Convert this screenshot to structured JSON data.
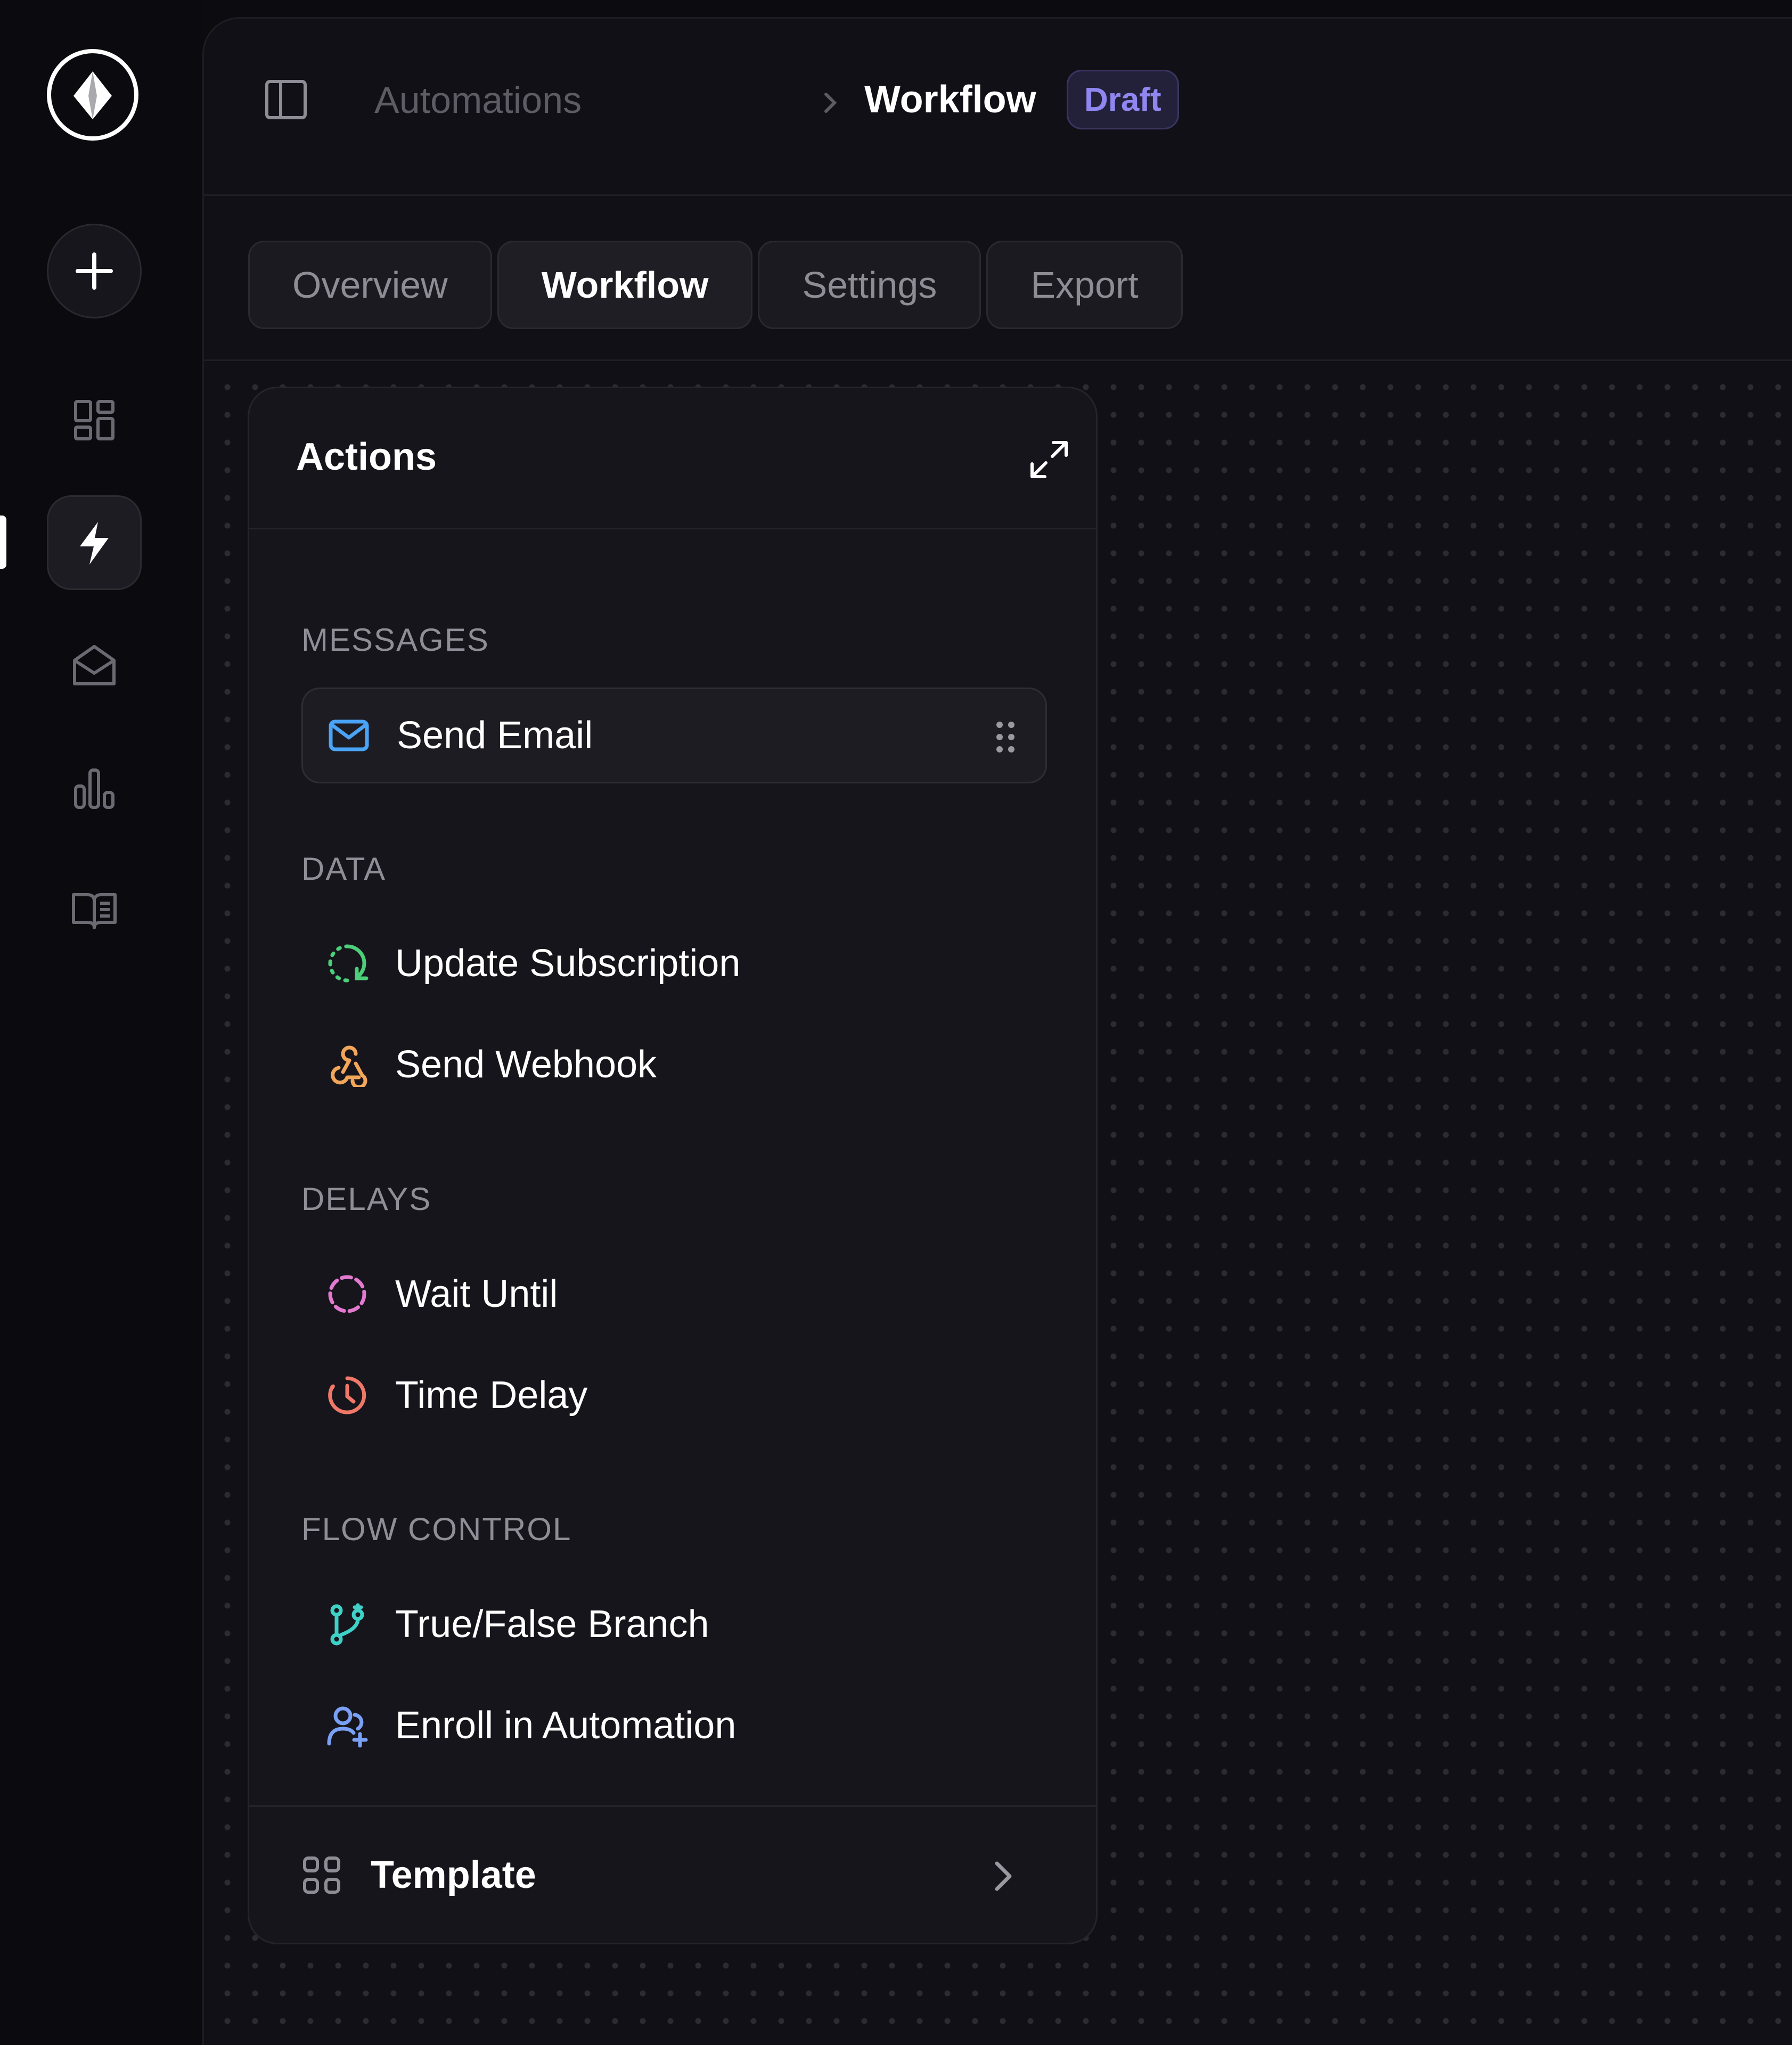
{
  "breadcrumb": {
    "parent": "Automations",
    "current": "Workflow",
    "status_badge": "Draft"
  },
  "tabs": [
    {
      "label": "Overview",
      "active": false
    },
    {
      "label": "Workflow",
      "active": true
    },
    {
      "label": "Settings",
      "active": false
    },
    {
      "label": "Export",
      "active": false
    }
  ],
  "rail": {
    "items": [
      {
        "icon": "logo-diamond-icon"
      },
      {
        "icon": "plus-icon"
      },
      {
        "icon": "dashboard-grid-icon"
      },
      {
        "icon": "lightning-bolt-icon",
        "active": true
      },
      {
        "icon": "mail-open-icon"
      },
      {
        "icon": "bar-chart-icon"
      },
      {
        "icon": "book-open-icon"
      }
    ]
  },
  "panel": {
    "title": "Actions",
    "sections": [
      {
        "label": "MESSAGES",
        "items": [
          {
            "label": "Send Email",
            "icon": "mail-icon",
            "color": "#4aa3f5"
          }
        ]
      },
      {
        "label": "DATA",
        "items": [
          {
            "label": "Update Subscription",
            "icon": "refresh-circle-icon",
            "color": "#4ccf7a"
          },
          {
            "label": "Send Webhook",
            "icon": "webhook-icon",
            "color": "#f2a65a"
          }
        ]
      },
      {
        "label": "DELAYS",
        "items": [
          {
            "label": "Wait Until",
            "icon": "dashed-circle-icon",
            "color": "#e37ad0"
          },
          {
            "label": "Time Delay",
            "icon": "clock-icon",
            "color": "#f07868"
          }
        ]
      },
      {
        "label": "FLOW CONTROL",
        "items": [
          {
            "label": "True/False Branch",
            "icon": "git-branch-icon",
            "color": "#3fd1c8"
          },
          {
            "label": "Enroll in Automation",
            "icon": "user-plus-icon",
            "color": "#7aa0f5"
          }
        ]
      }
    ],
    "footer": {
      "label": "Template",
      "icon": "template-grid-icon"
    }
  },
  "colors": {
    "background": "#0c0b0f",
    "surface": "#16151b",
    "accent": "#8f86f0",
    "badge_bg": "#23203a"
  }
}
